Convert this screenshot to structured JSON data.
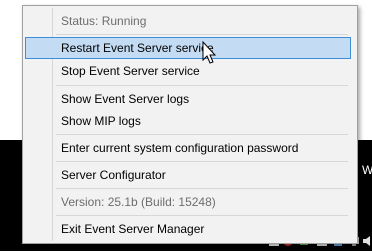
{
  "menu": {
    "status": "Status: Running",
    "restart": "Restart Event Server service",
    "stop": "Stop Event Server service",
    "show_event_logs": "Show Event Server logs",
    "show_mip_logs": "Show MIP logs",
    "enter_password": "Enter current system configuration password",
    "configurator": "Server Configurator",
    "version": "Version: 25.1b (Build: 15248)",
    "exit": "Exit Event Server Manager",
    "hovered_item": "restart"
  },
  "taskbar": {
    "partial_text": "W",
    "tray_icons": [
      "shield-icon",
      "network-icon",
      "usb-icon",
      "folder-icon",
      "server-icon",
      "display-icon",
      "speaker-icon"
    ]
  },
  "colors": {
    "menu_background": "#f2f2f2",
    "hover_fill": "#c3dcf3",
    "hover_border": "#3c8fd6",
    "taskbar": "#000000"
  }
}
